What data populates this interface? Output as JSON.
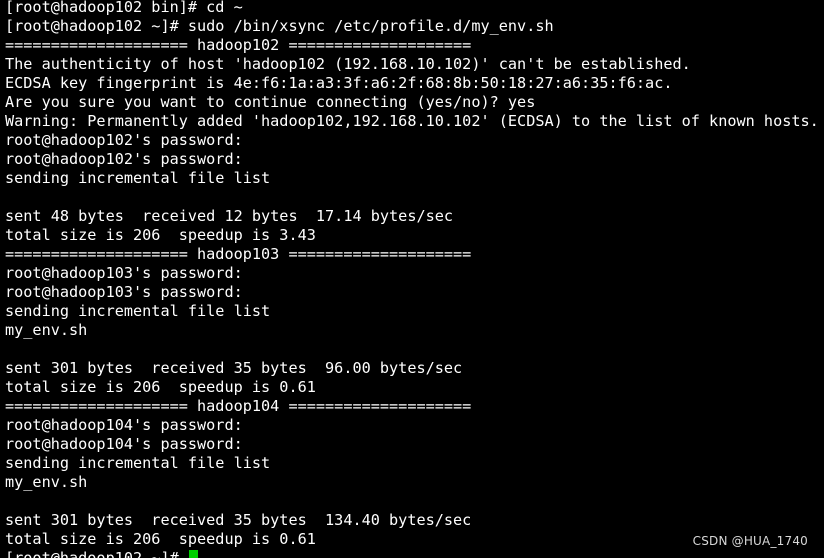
{
  "terminal": {
    "lines": [
      "[root@hadoop102 bin]# cd ~",
      "[root@hadoop102 ~]# sudo /bin/xsync /etc/profile.d/my_env.sh",
      "==================== hadoop102 ====================",
      "The authenticity of host 'hadoop102 (192.168.10.102)' can't be established.",
      "ECDSA key fingerprint is 4e:f6:1a:a3:3f:a6:2f:68:8b:50:18:27:a6:35:f6:ac.",
      "Are you sure you want to continue connecting (yes/no)? yes",
      "Warning: Permanently added 'hadoop102,192.168.10.102' (ECDSA) to the list of known hosts.",
      "root@hadoop102's password:",
      "root@hadoop102's password:",
      "sending incremental file list",
      "",
      "sent 48 bytes  received 12 bytes  17.14 bytes/sec",
      "total size is 206  speedup is 3.43",
      "==================== hadoop103 ====================",
      "root@hadoop103's password:",
      "root@hadoop103's password:",
      "sending incremental file list",
      "my_env.sh",
      "",
      "sent 301 bytes  received 35 bytes  96.00 bytes/sec",
      "total size is 206  speedup is 0.61",
      "==================== hadoop104 ====================",
      "root@hadoop104's password:",
      "root@hadoop104's password:",
      "sending incremental file list",
      "my_env.sh",
      "",
      "sent 301 bytes  received 35 bytes  134.40 bytes/sec",
      "total size is 206  speedup is 0.61"
    ],
    "prompt": "[root@hadoop102 ~]# ",
    "cursor_color": "#00d000",
    "text_color": "#ffffff",
    "background_color": "#000000"
  },
  "watermark": {
    "text": "CSDN @HUA_1740"
  }
}
